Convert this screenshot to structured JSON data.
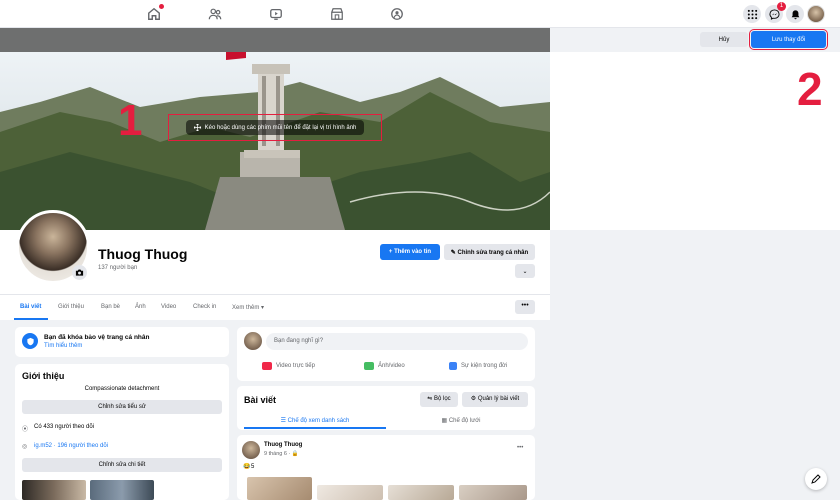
{
  "topbar": {
    "messenger_badge": "1"
  },
  "editbar": {
    "cancel_label": "Hủy",
    "save_label": "Lưu thay đổi"
  },
  "cover": {
    "drag_hint": "Kéo hoặc dùng các phím mũi tên để đặt lại vị trí hình ảnh"
  },
  "annotations": {
    "one": "1",
    "two": "2"
  },
  "profile": {
    "name": "Thuog Thuog",
    "friends": "137 người bạn",
    "add_story": "+ Thêm vào tin",
    "edit_profile": "Chỉnh sửa trang cá nhân",
    "more": "⌄"
  },
  "tabs": [
    "Bài viết",
    "Giới thiệu",
    "Bạn bè",
    "Ảnh",
    "Video",
    "Check in",
    "Xem thêm ▾"
  ],
  "tab_more": "•••",
  "lock_card": {
    "title": "Bạn đã khóa bảo vệ trang cá nhân",
    "link": "Tìm hiểu thêm"
  },
  "intro": {
    "title": "Giới thiệu",
    "bio": "Compassionate detachment",
    "edit_bio": "Chỉnh sửa tiểu sử",
    "followers": "Có 433 người theo dõi",
    "instagram": "ig.m52 · 196 người theo dõi",
    "edit_details": "Chỉnh sửa chi tiết"
  },
  "composer": {
    "placeholder": "Bạn đang nghĩ gì?",
    "live": "Video trực tiếp",
    "photo": "Ảnh/video",
    "event": "Sự kiện trong đời"
  },
  "posts_card": {
    "title": "Bài viết",
    "filter": "Bộ lọc",
    "manage": "Quản lý bài viết",
    "list_view": "Chế độ xem danh sách",
    "grid_view": "Chế độ lưới"
  },
  "post": {
    "author": "Thuog Thuog",
    "date": "9 tháng 6 · ",
    "emoji": "😂",
    "reaction_count": "5",
    "menu": "•••"
  },
  "colors": {
    "accent": "#1877f2",
    "highlight": "#e41e3f"
  }
}
